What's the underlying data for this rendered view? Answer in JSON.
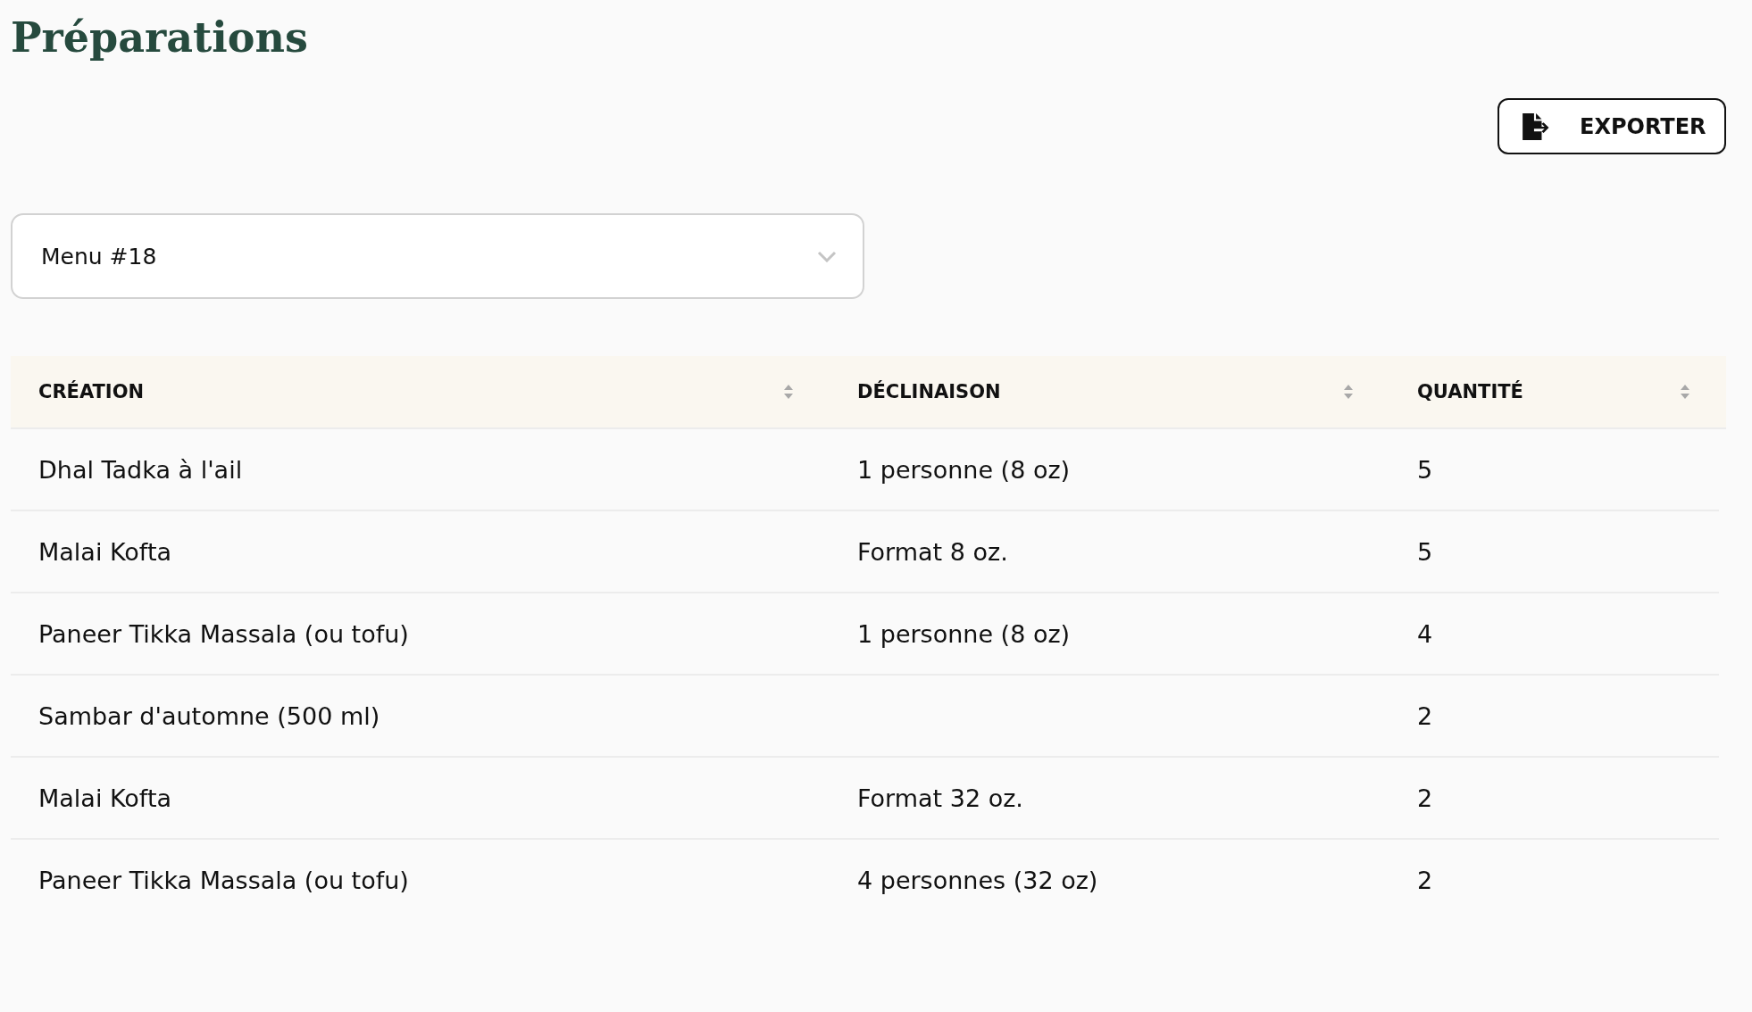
{
  "title": "Préparations",
  "export_button": {
    "label": "EXPORTER"
  },
  "menu_select": {
    "value": "Menu #18"
  },
  "table": {
    "columns": [
      "CRÉATION",
      "DÉCLINAISON",
      "QUANTITÉ"
    ],
    "rows": [
      {
        "creation": "Dhal Tadka à l'ail",
        "declinaison": "1 personne (8 oz)",
        "quantite": "5"
      },
      {
        "creation": "Malai Kofta",
        "declinaison": "Format 8 oz.",
        "quantite": "5"
      },
      {
        "creation": "Paneer Tikka Massala (ou tofu)",
        "declinaison": "1 personne (8 oz)",
        "quantite": "4"
      },
      {
        "creation": "Sambar d'automne (500 ml)",
        "quantite": "2"
      },
      {
        "creation": "Malai Kofta",
        "declinaison": "Format 32 oz.",
        "quantite": "2"
      },
      {
        "creation": "Paneer Tikka Massala (ou tofu)",
        "declinaison": "4 personnes (32 oz)",
        "quantite": "2"
      }
    ]
  }
}
